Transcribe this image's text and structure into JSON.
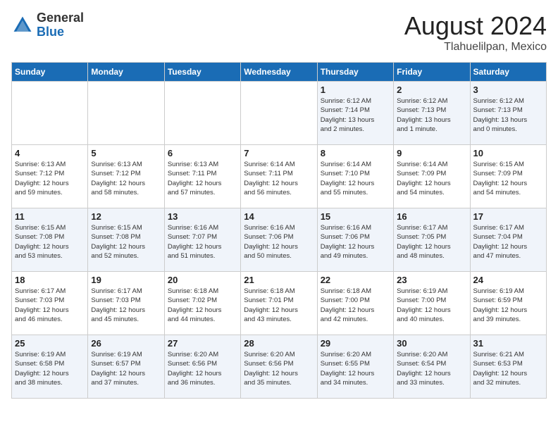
{
  "header": {
    "logo_general": "General",
    "logo_blue": "Blue",
    "month_year": "August 2024",
    "location": "Tlahuelilpan, Mexico"
  },
  "days_of_week": [
    "Sunday",
    "Monday",
    "Tuesday",
    "Wednesday",
    "Thursday",
    "Friday",
    "Saturday"
  ],
  "weeks": [
    [
      {
        "day": "",
        "info": ""
      },
      {
        "day": "",
        "info": ""
      },
      {
        "day": "",
        "info": ""
      },
      {
        "day": "",
        "info": ""
      },
      {
        "day": "1",
        "info": "Sunrise: 6:12 AM\nSunset: 7:14 PM\nDaylight: 13 hours\nand 2 minutes."
      },
      {
        "day": "2",
        "info": "Sunrise: 6:12 AM\nSunset: 7:13 PM\nDaylight: 13 hours\nand 1 minute."
      },
      {
        "day": "3",
        "info": "Sunrise: 6:12 AM\nSunset: 7:13 PM\nDaylight: 13 hours\nand 0 minutes."
      }
    ],
    [
      {
        "day": "4",
        "info": "Sunrise: 6:13 AM\nSunset: 7:12 PM\nDaylight: 12 hours\nand 59 minutes."
      },
      {
        "day": "5",
        "info": "Sunrise: 6:13 AM\nSunset: 7:12 PM\nDaylight: 12 hours\nand 58 minutes."
      },
      {
        "day": "6",
        "info": "Sunrise: 6:13 AM\nSunset: 7:11 PM\nDaylight: 12 hours\nand 57 minutes."
      },
      {
        "day": "7",
        "info": "Sunrise: 6:14 AM\nSunset: 7:11 PM\nDaylight: 12 hours\nand 56 minutes."
      },
      {
        "day": "8",
        "info": "Sunrise: 6:14 AM\nSunset: 7:10 PM\nDaylight: 12 hours\nand 55 minutes."
      },
      {
        "day": "9",
        "info": "Sunrise: 6:14 AM\nSunset: 7:09 PM\nDaylight: 12 hours\nand 54 minutes."
      },
      {
        "day": "10",
        "info": "Sunrise: 6:15 AM\nSunset: 7:09 PM\nDaylight: 12 hours\nand 54 minutes."
      }
    ],
    [
      {
        "day": "11",
        "info": "Sunrise: 6:15 AM\nSunset: 7:08 PM\nDaylight: 12 hours\nand 53 minutes."
      },
      {
        "day": "12",
        "info": "Sunrise: 6:15 AM\nSunset: 7:08 PM\nDaylight: 12 hours\nand 52 minutes."
      },
      {
        "day": "13",
        "info": "Sunrise: 6:16 AM\nSunset: 7:07 PM\nDaylight: 12 hours\nand 51 minutes."
      },
      {
        "day": "14",
        "info": "Sunrise: 6:16 AM\nSunset: 7:06 PM\nDaylight: 12 hours\nand 50 minutes."
      },
      {
        "day": "15",
        "info": "Sunrise: 6:16 AM\nSunset: 7:06 PM\nDaylight: 12 hours\nand 49 minutes."
      },
      {
        "day": "16",
        "info": "Sunrise: 6:17 AM\nSunset: 7:05 PM\nDaylight: 12 hours\nand 48 minutes."
      },
      {
        "day": "17",
        "info": "Sunrise: 6:17 AM\nSunset: 7:04 PM\nDaylight: 12 hours\nand 47 minutes."
      }
    ],
    [
      {
        "day": "18",
        "info": "Sunrise: 6:17 AM\nSunset: 7:03 PM\nDaylight: 12 hours\nand 46 minutes."
      },
      {
        "day": "19",
        "info": "Sunrise: 6:17 AM\nSunset: 7:03 PM\nDaylight: 12 hours\nand 45 minutes."
      },
      {
        "day": "20",
        "info": "Sunrise: 6:18 AM\nSunset: 7:02 PM\nDaylight: 12 hours\nand 44 minutes."
      },
      {
        "day": "21",
        "info": "Sunrise: 6:18 AM\nSunset: 7:01 PM\nDaylight: 12 hours\nand 43 minutes."
      },
      {
        "day": "22",
        "info": "Sunrise: 6:18 AM\nSunset: 7:00 PM\nDaylight: 12 hours\nand 42 minutes."
      },
      {
        "day": "23",
        "info": "Sunrise: 6:19 AM\nSunset: 7:00 PM\nDaylight: 12 hours\nand 40 minutes."
      },
      {
        "day": "24",
        "info": "Sunrise: 6:19 AM\nSunset: 6:59 PM\nDaylight: 12 hours\nand 39 minutes."
      }
    ],
    [
      {
        "day": "25",
        "info": "Sunrise: 6:19 AM\nSunset: 6:58 PM\nDaylight: 12 hours\nand 38 minutes."
      },
      {
        "day": "26",
        "info": "Sunrise: 6:19 AM\nSunset: 6:57 PM\nDaylight: 12 hours\nand 37 minutes."
      },
      {
        "day": "27",
        "info": "Sunrise: 6:20 AM\nSunset: 6:56 PM\nDaylight: 12 hours\nand 36 minutes."
      },
      {
        "day": "28",
        "info": "Sunrise: 6:20 AM\nSunset: 6:56 PM\nDaylight: 12 hours\nand 35 minutes."
      },
      {
        "day": "29",
        "info": "Sunrise: 6:20 AM\nSunset: 6:55 PM\nDaylight: 12 hours\nand 34 minutes."
      },
      {
        "day": "30",
        "info": "Sunrise: 6:20 AM\nSunset: 6:54 PM\nDaylight: 12 hours\nand 33 minutes."
      },
      {
        "day": "31",
        "info": "Sunrise: 6:21 AM\nSunset: 6:53 PM\nDaylight: 12 hours\nand 32 minutes."
      }
    ]
  ],
  "accent_color": "#1a6cb5"
}
